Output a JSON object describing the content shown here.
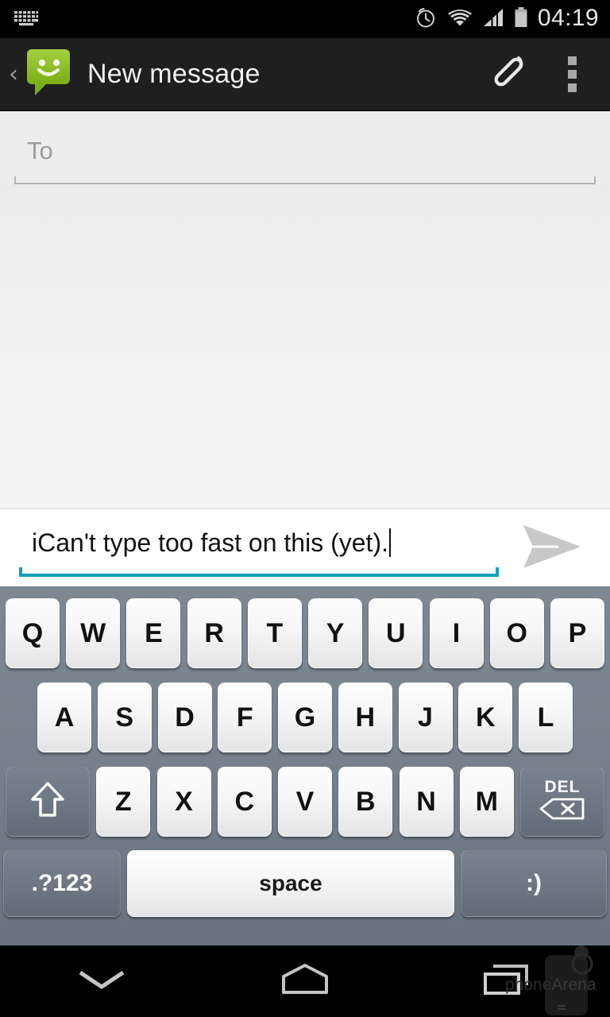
{
  "status_bar": {
    "keyboard_icon": "keyboard-icon",
    "alarm_icon": "alarm-clock-icon",
    "wifi_icon": "wifi-icon",
    "signal_icon": "cellular-signal-icon",
    "battery_icon": "battery-icon",
    "time": "04:19"
  },
  "action_bar": {
    "back_label": "‹",
    "app_icon": "messaging-app-icon",
    "title": "New message",
    "attach_icon": "paperclip-attach-icon",
    "overflow_icon": "overflow-menu-icon"
  },
  "recipient": {
    "placeholder": "To",
    "value": ""
  },
  "compose": {
    "message": "iCan't type too fast on this (yet).",
    "send_icon": "send-arrow-icon",
    "accent_color": "#159fbb"
  },
  "keyboard": {
    "row1": [
      "Q",
      "W",
      "E",
      "R",
      "T",
      "Y",
      "U",
      "I",
      "O",
      "P"
    ],
    "row2": [
      "A",
      "S",
      "D",
      "F",
      "G",
      "H",
      "J",
      "K",
      "L"
    ],
    "row3_letters": [
      "Z",
      "X",
      "C",
      "V",
      "B",
      "N",
      "M"
    ],
    "shift_label": "shift-key",
    "delete_label": "DEL",
    "symbols_label": ".?123",
    "space_label": "space",
    "emoji_label": ":)",
    "bg_color": "#78828e"
  },
  "nav_bar": {
    "back_label": "hide-keyboard-chevron",
    "home_label": "home-button",
    "recents_label": "recent-apps-button"
  },
  "watermark": {
    "text_left": "phone",
    "text_right": "Arena"
  }
}
